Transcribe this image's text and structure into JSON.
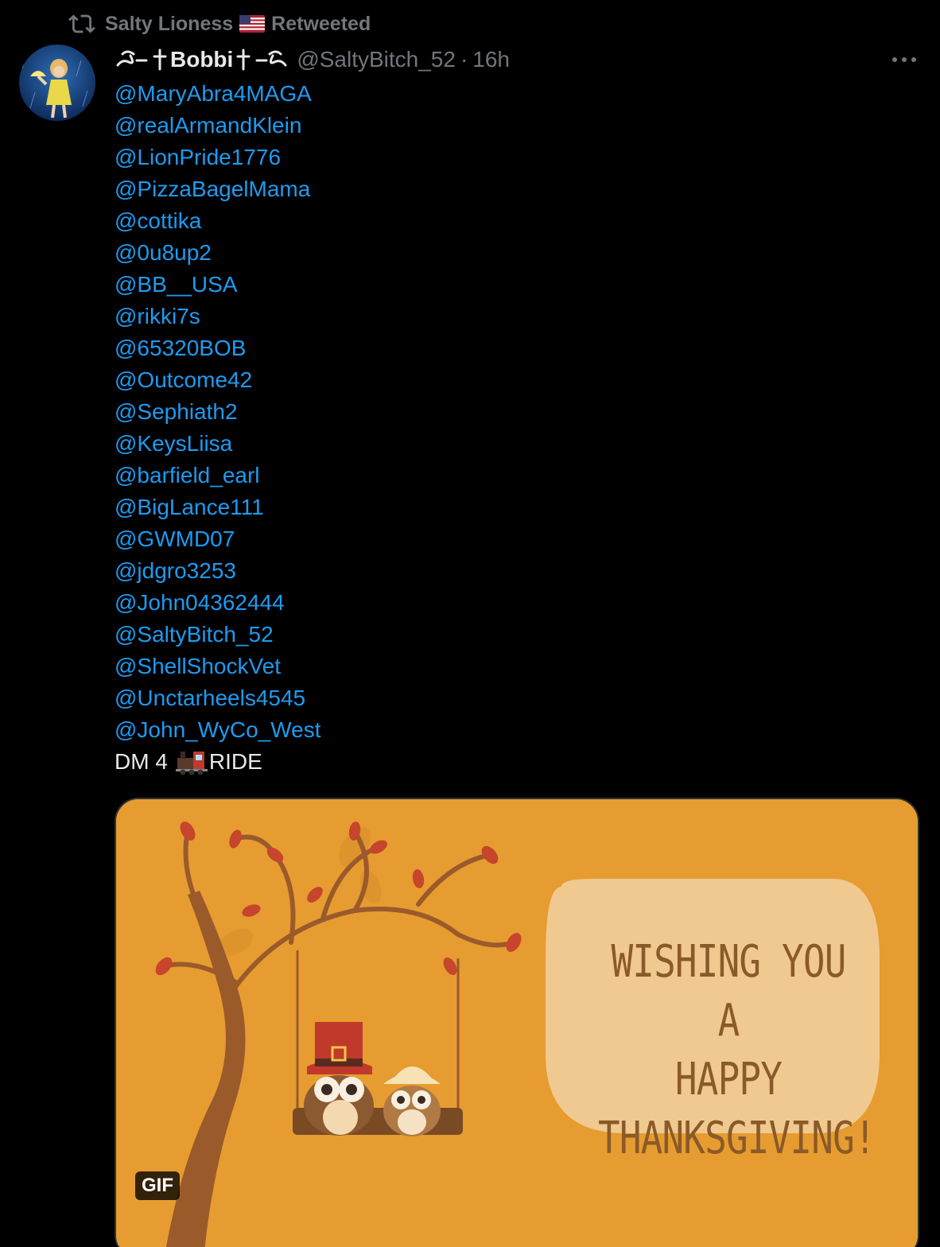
{
  "retweet": {
    "retweeter_name": "Salty Lioness",
    "retweeted_label": "Retweeted"
  },
  "author": {
    "display_name": "Bobbi",
    "handle": "@SaltyBitch_52",
    "separator": "·",
    "time": "16h"
  },
  "tweet": {
    "mentions": [
      "@MaryAbra4MAGA",
      "@realArmandKlein",
      "@LionPride1776",
      "@PizzaBagelMama",
      "@cottika",
      "@0u8up2",
      "@BB__USA",
      "@rikki7s",
      "@65320BOB",
      "@Outcome42",
      "@Sephiath2",
      "@KeysLiisa",
      "@barfield_earl",
      "@BigLance111",
      "@GWMD07",
      "@jdgro3253",
      "@John04362444",
      "@SaltyBitch_52",
      "@ShellShockVet",
      "@Unctarheels4545",
      "@John_WyCo_West"
    ],
    "dm_prefix": "DM 4",
    "dm_suffix": "RIDE"
  },
  "media": {
    "badge": "GIF",
    "message_lines": [
      "WISHING YOU A",
      "HAPPY",
      "THANKSGIVING!"
    ]
  },
  "colors": {
    "background": "#000000",
    "link": "#1d9bf0",
    "muted": "#71767b",
    "text": "#e7e9ea",
    "card_bg": "#e69c30"
  },
  "icons": {
    "retweet": "retweet-icon",
    "flag": "us-flag-icon",
    "more": "more-options-icon",
    "train": "locomotive-icon"
  }
}
